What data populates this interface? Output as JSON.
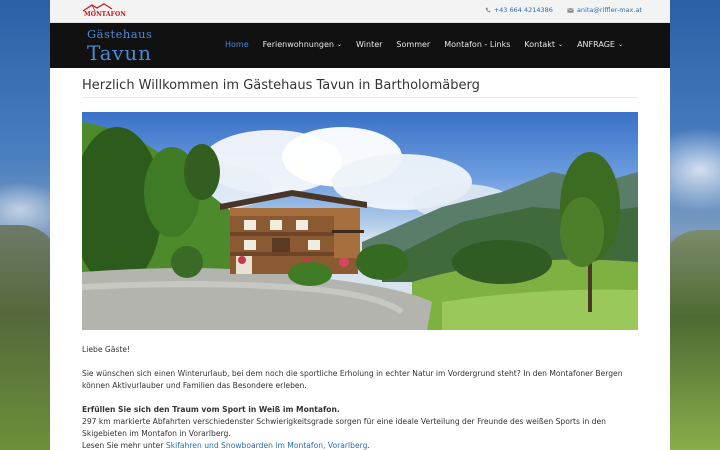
{
  "brand": {
    "logo_word": "MONTAFON"
  },
  "topbar": {
    "phone": "+43 664 4214386",
    "email": "anita@riffler-max.at"
  },
  "header": {
    "title_small": "Gästehaus",
    "title_big": "Tavun",
    "nav": [
      {
        "label": "Home",
        "active": true,
        "dropdown": false
      },
      {
        "label": "Ferienwohnungen",
        "active": false,
        "dropdown": true
      },
      {
        "label": "Winter",
        "active": false,
        "dropdown": false
      },
      {
        "label": "Sommer",
        "active": false,
        "dropdown": false
      },
      {
        "label": "Montafon - Links",
        "active": false,
        "dropdown": false
      },
      {
        "label": "Kontakt",
        "active": false,
        "dropdown": true
      },
      {
        "label": "ANFRAGE",
        "active": false,
        "dropdown": true
      }
    ],
    "dropdown_caret": "⌄"
  },
  "main": {
    "title": "Herzlich Willkommen im Gästehaus Tavun in Bartholomäberg",
    "greeting": "Liebe Gäste!",
    "intro": "Sie wünschen sich einen Winterurlaub, bei dem noch die sportliche Erholung in echter Natur im Vordergrund steht? In den Montafoner Bergen können Aktivurlauber und Familien das Besondere erleben.",
    "sport_heading": "Erfüllen Sie sich den Traum vom Sport in Weiß im Montafon.",
    "sport_text": "297 km markierte Abfahrten verschiedenster Schwierigkeitsgrade sorgen für eine ideale Verteilung der Freunde des weißen Sports in den Skigebieten im Montafon in Vorarlberg.",
    "read_more_prefix": "Lesen Sie mehr unter ",
    "read_more_link": "Skifahren und Snowboarden im Montafon, Vorarlberg",
    "read_more_suffix": "."
  },
  "colors": {
    "accent": "#2a6eb4",
    "header_bg": "#111111",
    "nav_active": "#3c8bdc",
    "logo_red": "#c4161c"
  },
  "icons": [
    "phone-icon",
    "envelope-icon",
    "chevron-down-icon"
  ]
}
